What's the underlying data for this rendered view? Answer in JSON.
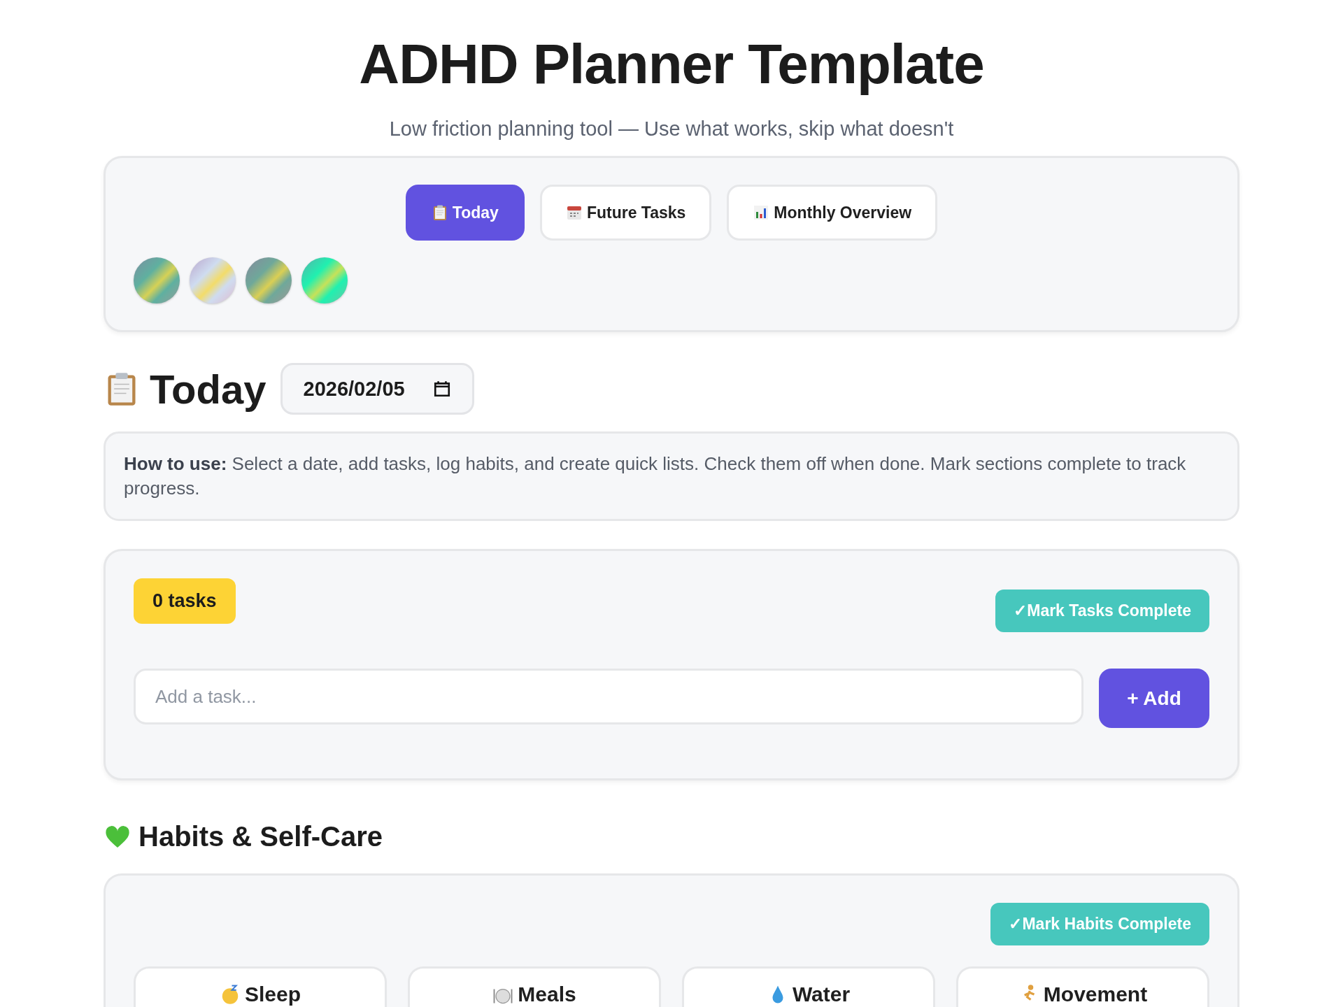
{
  "header": {
    "title": "ADHD Planner Template",
    "subtitle": "Low friction planning tool — Use what works, skip what doesn't"
  },
  "tabs": [
    {
      "label": "Today",
      "selected": true
    },
    {
      "label": "Future Tasks",
      "selected": false
    },
    {
      "label": "Monthly Overview",
      "selected": false
    }
  ],
  "theme_swatches": [
    {
      "color": "#5fb0a0"
    },
    {
      "color": "#cfdcf0"
    },
    {
      "color": "#6fa89a"
    },
    {
      "color": "#20f0b0"
    }
  ],
  "today": {
    "title": "Today",
    "date": "2026/02/05"
  },
  "how_to": "**How to use:** Select a date, add tasks, log habits, and create quick lists. Check them off when done. Mark sections complete to track progress.",
  "tasks": {
    "count": "0 tasks",
    "complete_button": "✓Mark Tasks Complete",
    "placeholder": "Add a task...",
    "add_button": "+ Add"
  },
  "habits": {
    "title": "Habits & Self-Care",
    "complete_button": "✓Mark Habits Complete",
    "cards": [
      {
        "title": "Sleep"
      },
      {
        "title": "Meals"
      },
      {
        "title": "Water"
      },
      {
        "title": "Movement"
      }
    ]
  }
}
